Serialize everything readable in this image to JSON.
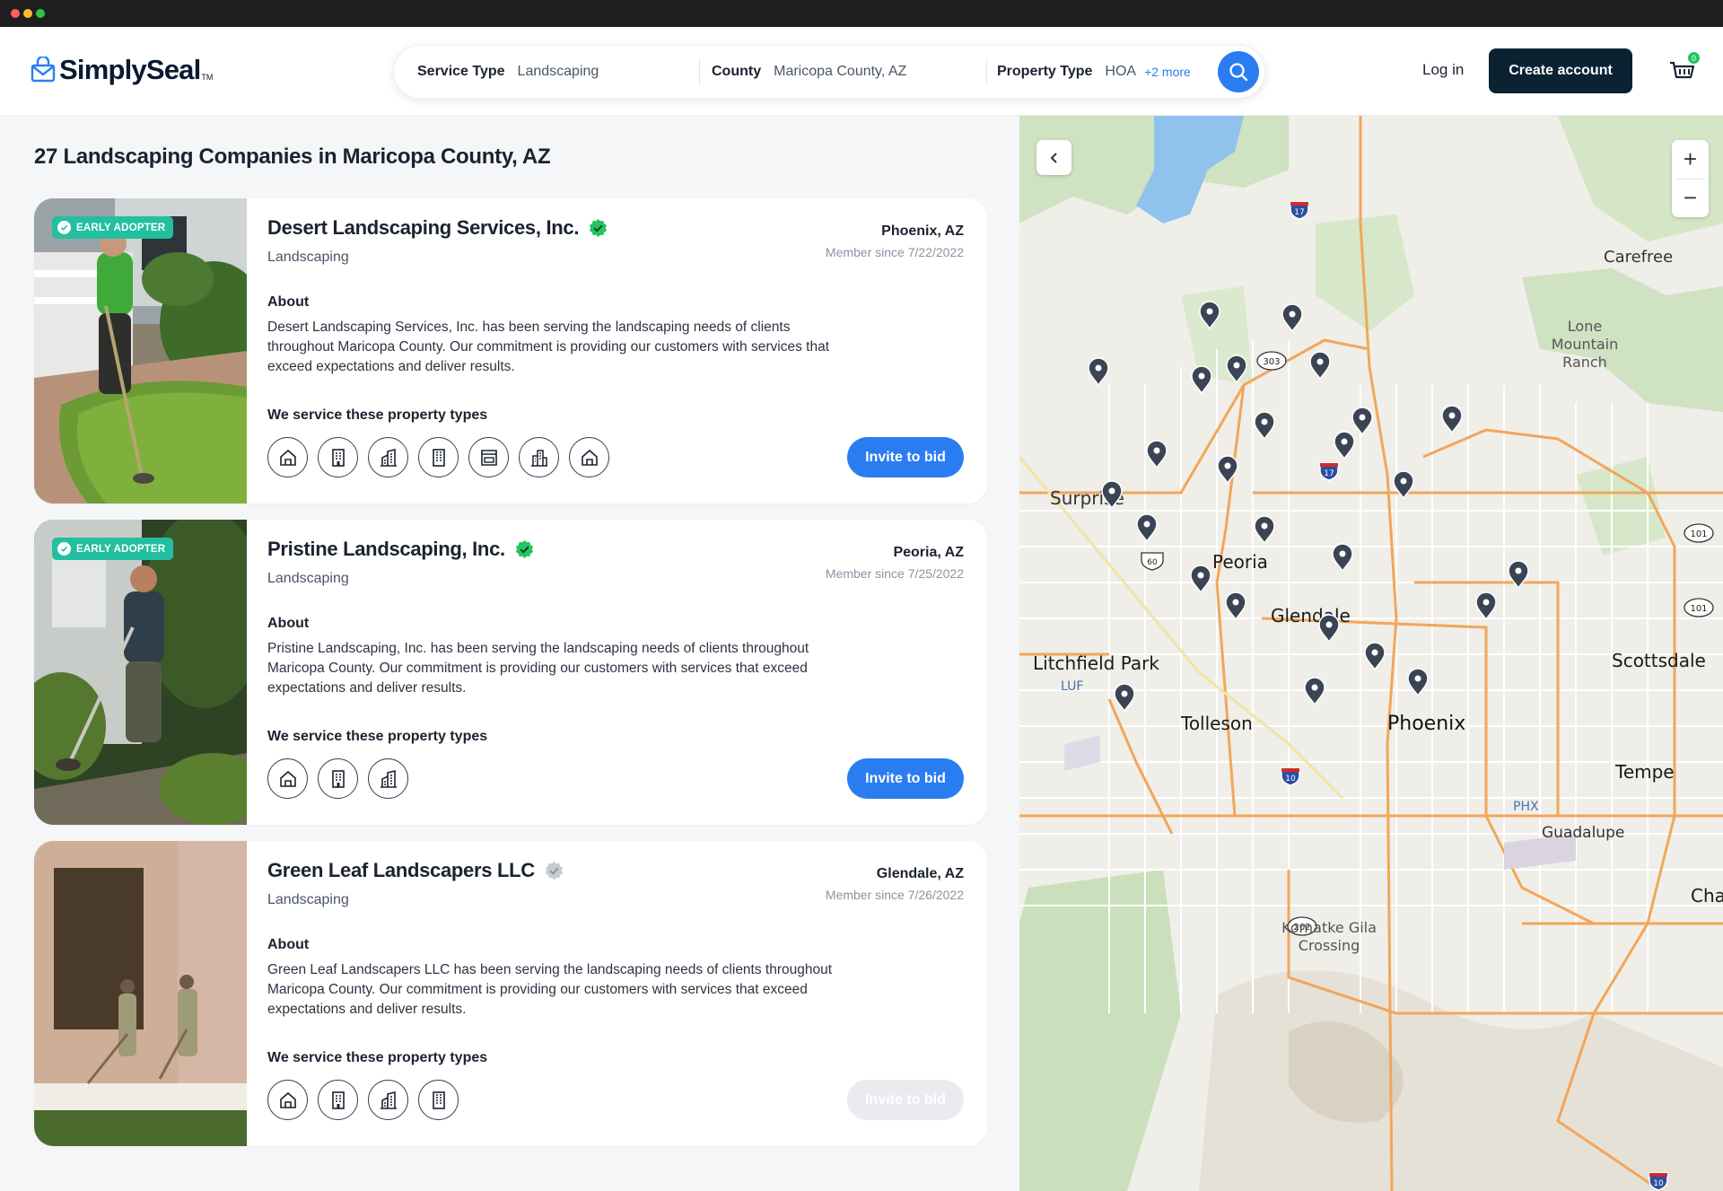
{
  "brand": {
    "name": "SimplySeal",
    "tm": "TM"
  },
  "search": {
    "service_type_label": "Service Type",
    "service_type_value": "Landscaping",
    "county_label": "County",
    "county_value": "Maricopa County, AZ",
    "property_type_label": "Property Type",
    "property_type_value": "HOA",
    "property_type_more": "+2 more"
  },
  "header": {
    "login": "Log in",
    "create_account": "Create account",
    "cart_count": "0"
  },
  "results": {
    "title": "27 Landscaping Companies in Maricopa County, AZ",
    "about_heading": "About",
    "ptypes_heading": "We service these property types",
    "early_adopter": "EARLY ADOPTER",
    "invite_label": "Invite to bid",
    "cards": [
      {
        "name": "Desert Landscaping Services, Inc.",
        "category": "Landscaping",
        "location": "Phoenix, AZ",
        "member_since": "Member since 7/22/2022",
        "about": "Desert Landscaping Services, Inc. has been serving the landscaping needs of clients throughout Maricopa County. Our commitment is providing our customers with services that exceed expectations and deliver results.",
        "verified": true,
        "early_adopter": true,
        "invite_enabled": true,
        "property_type_icons": [
          "house-icon",
          "office-building-icon",
          "commercial-building-icon",
          "apartment-building-icon",
          "storefront-icon",
          "city-buildings-icon",
          "home-icon"
        ]
      },
      {
        "name": "Pristine Landscaping, Inc.",
        "category": "Landscaping",
        "location": "Peoria, AZ",
        "member_since": "Member since 7/25/2022",
        "about": "Pristine Landscaping, Inc. has been serving the landscaping needs of clients throughout Maricopa County. Our commitment is providing our customers with services that exceed expectations and deliver results.",
        "verified": true,
        "early_adopter": true,
        "invite_enabled": true,
        "property_type_icons": [
          "house-icon",
          "office-building-icon",
          "commercial-building-icon"
        ]
      },
      {
        "name": "Green Leaf Landscapers LLC",
        "category": "Landscaping",
        "location": "Glendale, AZ",
        "member_since": "Member since 7/26/2022",
        "about": "Green Leaf Landscapers LLC has been serving the landscaping needs of clients throughout Maricopa County. Our commitment is providing our customers with services that exceed expectations and deliver results.",
        "verified": false,
        "early_adopter": false,
        "invite_enabled": false,
        "property_type_icons": [
          "house-icon",
          "office-building-icon",
          "commercial-building-icon",
          "apartment-building-icon"
        ]
      }
    ]
  },
  "map": {
    "cities": [
      "Carefree",
      "Lone Mountain Ranch",
      "Surprise",
      "Peoria",
      "Glendale",
      "Scottsdale",
      "Litchfield Park",
      "Tolleson",
      "Phoenix",
      "Tempe",
      "Guadalupe",
      "Komatke Gila Crossing",
      "Cha"
    ],
    "airports": [
      "LUF",
      "PHX"
    ],
    "highways": [
      "17",
      "303",
      "17",
      "101",
      "101",
      "60",
      "10",
      "202",
      "10"
    ],
    "zoom_in": "+",
    "zoom_out": "−"
  },
  "colors": {
    "accent": "#2a7df1",
    "dark": "#0b2233",
    "early_adopter": "#22bfa0",
    "verified": "#22c55e",
    "pin": "#3a4454"
  }
}
